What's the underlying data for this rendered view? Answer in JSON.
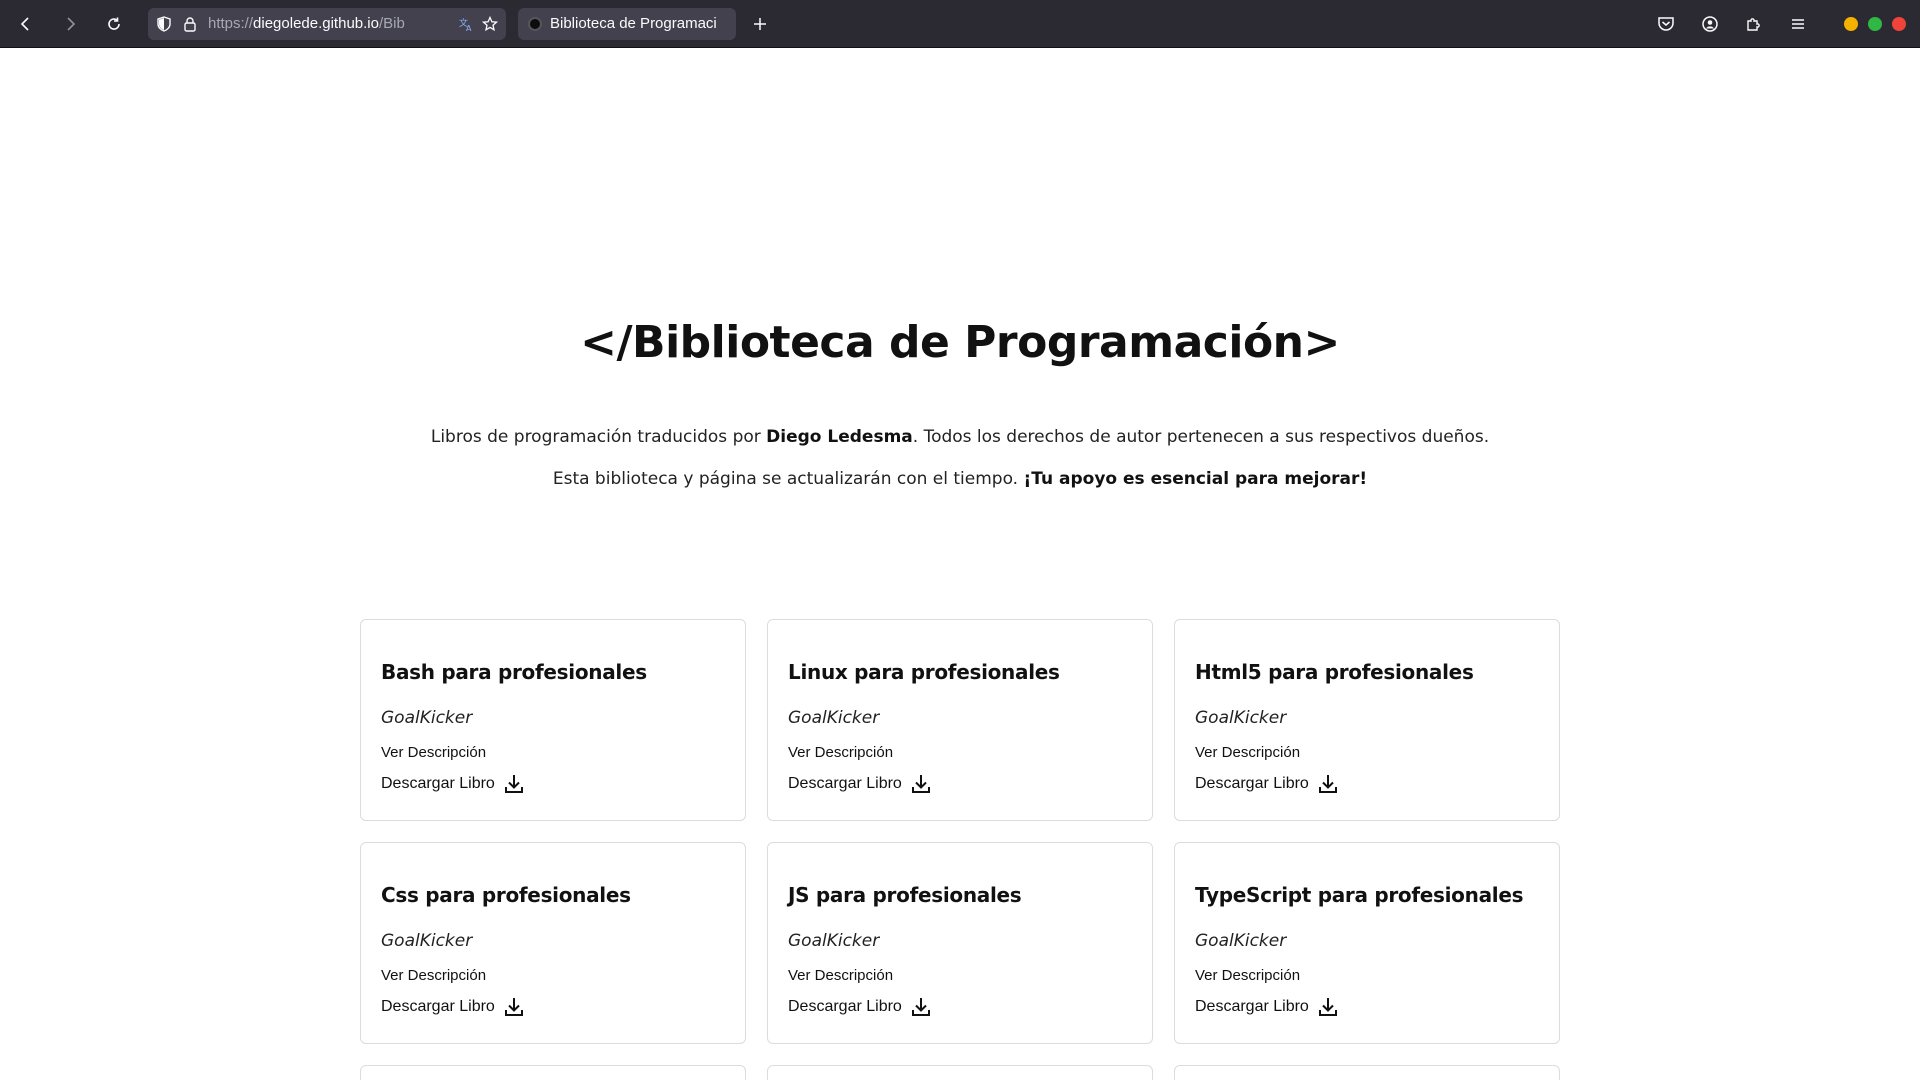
{
  "browser": {
    "url_prefix": "https://",
    "url_domain": "diegolede.github.io",
    "url_path": "/Bib",
    "tab_title": "Biblioteca de Programaci",
    "traffic_colors": [
      "#f5b100",
      "#2fb843",
      "#f0433a"
    ]
  },
  "header": {
    "title": "</Biblioteca de Programación>",
    "intro_1_pre": "Libros de programación traducidos por ",
    "intro_1_author": "Diego Ledesma",
    "intro_1_post": ". Todos los derechos de autor pertenecen a sus respectivos dueños.",
    "intro_2_pre": "Esta biblioteca y página se actualizarán con el tiempo. ",
    "intro_2_bold": "¡Tu apoyo es esencial para mejorar!"
  },
  "books": [
    {
      "title": "Bash para profesionales",
      "author": "GoalKicker",
      "desc_label": "Ver Descripción",
      "download_label": "Descargar Libro"
    },
    {
      "title": "Linux para profesionales",
      "author": "GoalKicker",
      "desc_label": "Ver Descripción",
      "download_label": "Descargar Libro"
    },
    {
      "title": "Html5 para profesionales",
      "author": "GoalKicker",
      "desc_label": "Ver Descripción",
      "download_label": "Descargar Libro"
    },
    {
      "title": "Css para profesionales",
      "author": "GoalKicker",
      "desc_label": "Ver Descripción",
      "download_label": "Descargar Libro"
    },
    {
      "title": "JS para profesionales",
      "author": "GoalKicker",
      "desc_label": "Ver Descripción",
      "download_label": "Descargar Libro"
    },
    {
      "title": "TypeScript para profesionales",
      "author": "GoalKicker",
      "desc_label": "Ver Descripción",
      "download_label": "Descargar Libro"
    }
  ]
}
